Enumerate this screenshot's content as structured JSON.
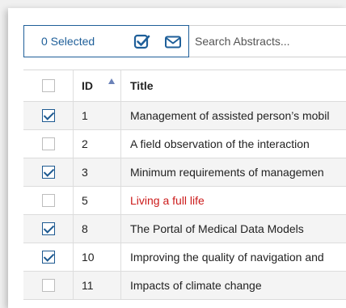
{
  "toolbar": {
    "selected_label": "0 Selected",
    "search": {
      "placeholder": "Search Abstracts..."
    }
  },
  "table": {
    "headers": {
      "id": "ID",
      "title": "Title"
    },
    "rows": [
      {
        "id": "1",
        "title": "Management of assisted person’s mobil",
        "checked": true,
        "highlight": false
      },
      {
        "id": "2",
        "title": "A field observation of the interaction",
        "checked": false,
        "highlight": false
      },
      {
        "id": "3",
        "title": "Minimum requirements of managemen",
        "checked": true,
        "highlight": false
      },
      {
        "id": "5",
        "title": "Living a full life",
        "checked": false,
        "highlight": true
      },
      {
        "id": "8",
        "title": "The Portal of Medical Data Models",
        "checked": true,
        "highlight": false
      },
      {
        "id": "10",
        "title": "Improving the quality of navigation and",
        "checked": true,
        "highlight": false
      },
      {
        "id": "11",
        "title": "Impacts of climate change",
        "checked": false,
        "highlight": false
      }
    ]
  },
  "colors": {
    "accent": "#1f5f99",
    "highlight_text": "#cc1b1b"
  }
}
